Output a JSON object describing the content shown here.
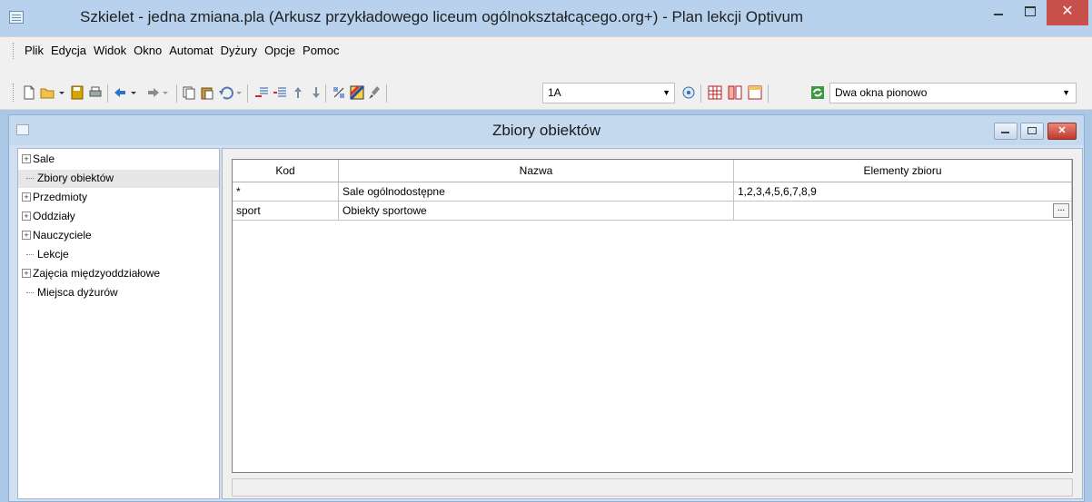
{
  "window": {
    "title": "Szkielet - jedna zmiana.pla (Arkusz przykładowego liceum ogólnokształcącego.org+) - Plan lekcji Optivum",
    "close_glyph": "✕"
  },
  "menu": {
    "items": [
      "Plik",
      "Edycja",
      "Widok",
      "Okno",
      "Automat",
      "Dyżury",
      "Opcje",
      "Pomoc"
    ]
  },
  "toolbar": {
    "class_select_value": "1A",
    "layout_select_value": "Dwa okna pionowo",
    "icons": [
      "new-icon",
      "open-icon",
      "save-icon",
      "print-icon",
      "back-icon",
      "forward-icon",
      "copy-icon",
      "paste-icon",
      "undo-icon",
      "insert-row-icon",
      "delete-row-icon",
      "move-up-icon",
      "move-down-icon",
      "wand-icon",
      "color-icon",
      "brush-icon",
      "preview-icon",
      "grid-icon",
      "split-icon",
      "table-icon",
      "refresh-icon"
    ]
  },
  "child_window": {
    "title": "Zbiory obiektów",
    "close_glyph": "✕"
  },
  "tree": {
    "items": [
      {
        "label": "Sale",
        "expandable": true
      },
      {
        "label": "Zbiory obiektów",
        "expandable": false,
        "selected": true
      },
      {
        "label": "Przedmioty",
        "expandable": true
      },
      {
        "label": "Oddziały",
        "expandable": true
      },
      {
        "label": "Nauczyciele",
        "expandable": true
      },
      {
        "label": "Lekcje",
        "expandable": false
      },
      {
        "label": "Zajęcia międzyoddziałowe",
        "expandable": true
      },
      {
        "label": "Miejsca dyżurów",
        "expandable": false
      }
    ]
  },
  "table": {
    "columns": [
      "Kod",
      "Nazwa",
      "Elementy zbioru"
    ],
    "rows": [
      [
        "*",
        "Sale ogólnodostępne",
        "1,2,3,4,5,6,7,8,9"
      ],
      [
        "sport",
        "Obiekty sportowe",
        ""
      ]
    ],
    "ellipsis_button": "..."
  },
  "colors": {
    "titlebar": "#b8d1ec",
    "close_button": "#c7504a",
    "mdi_frame": "#cfe0f3"
  }
}
